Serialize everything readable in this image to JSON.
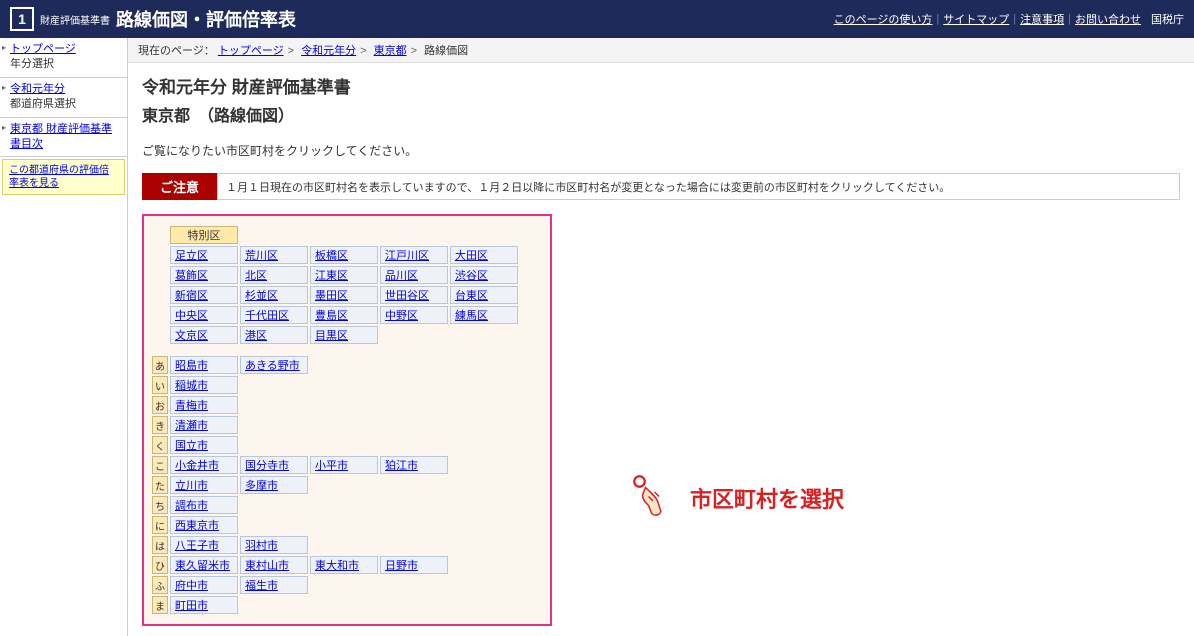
{
  "header": {
    "icon": "1",
    "sub": "財産評価基準書",
    "title": "路線価図・評価倍率表",
    "links": [
      "このページの使い方",
      "サイトマップ",
      "注意事項",
      "お問い合わせ"
    ],
    "agency": "国税庁"
  },
  "sidebar": {
    "items": [
      {
        "link": "トップページ",
        "sub": "年分選択"
      },
      {
        "link": "令和元年分",
        "sub": "都道府県選択"
      },
      {
        "link": "東京都  財産評価基準書目次",
        "sub": ""
      }
    ],
    "note_link": "この都道府県の評価倍率表を見る"
  },
  "breadcrumb": {
    "label": "現在のページ：",
    "items": [
      "トップページ",
      "令和元年分",
      "東京都"
    ],
    "current": "路線価図"
  },
  "page": {
    "title": "令和元年分 財産評価基準書",
    "subtitle": "東京都　（路線価図）",
    "instruction": "ご覧になりたい市区町村をクリックしてください。",
    "notice_label": "ご注意",
    "notice_text": "１月１日現在の市区町村名を表示していますので、１月２日以降に市区町村名が変更となった場合には変更前の市区町村をクリックしてください。"
  },
  "wards": {
    "header": "特別区",
    "rows": [
      [
        "足立区",
        "荒川区",
        "板橋区",
        "江戸川区",
        "大田区"
      ],
      [
        "葛飾区",
        "北区",
        "江東区",
        "品川区",
        "渋谷区"
      ],
      [
        "新宿区",
        "杉並区",
        "墨田区",
        "世田谷区",
        "台東区"
      ],
      [
        "中央区",
        "千代田区",
        "豊島区",
        "中野区",
        "練馬区"
      ],
      [
        "文京区",
        "港区",
        "目黒区"
      ]
    ]
  },
  "cities": [
    {
      "idx": "あ",
      "cells": [
        "昭島市",
        "あきる野市"
      ]
    },
    {
      "idx": "い",
      "cells": [
        "稲城市"
      ]
    },
    {
      "idx": "お",
      "cells": [
        "青梅市"
      ]
    },
    {
      "idx": "き",
      "cells": [
        "清瀬市"
      ]
    },
    {
      "idx": "く",
      "cells": [
        "国立市"
      ]
    },
    {
      "idx": "こ",
      "cells": [
        "小金井市",
        "国分寺市",
        "小平市",
        "狛江市"
      ]
    },
    {
      "idx": "た",
      "cells": [
        "立川市",
        "多摩市"
      ]
    },
    {
      "idx": "ち",
      "cells": [
        "調布市"
      ]
    },
    {
      "idx": "に",
      "cells": [
        "西東京市"
      ]
    },
    {
      "idx": "は",
      "cells": [
        "八王子市",
        "羽村市"
      ]
    },
    {
      "idx": "ひ",
      "cells": [
        "東久留米市",
        "東村山市",
        "東大和市",
        "日野市"
      ]
    },
    {
      "idx": "ふ",
      "cells": [
        "府中市",
        "福生市"
      ]
    },
    {
      "idx": "ま",
      "cells": [
        "町田市"
      ]
    }
  ],
  "callout": "市区町村を選択"
}
